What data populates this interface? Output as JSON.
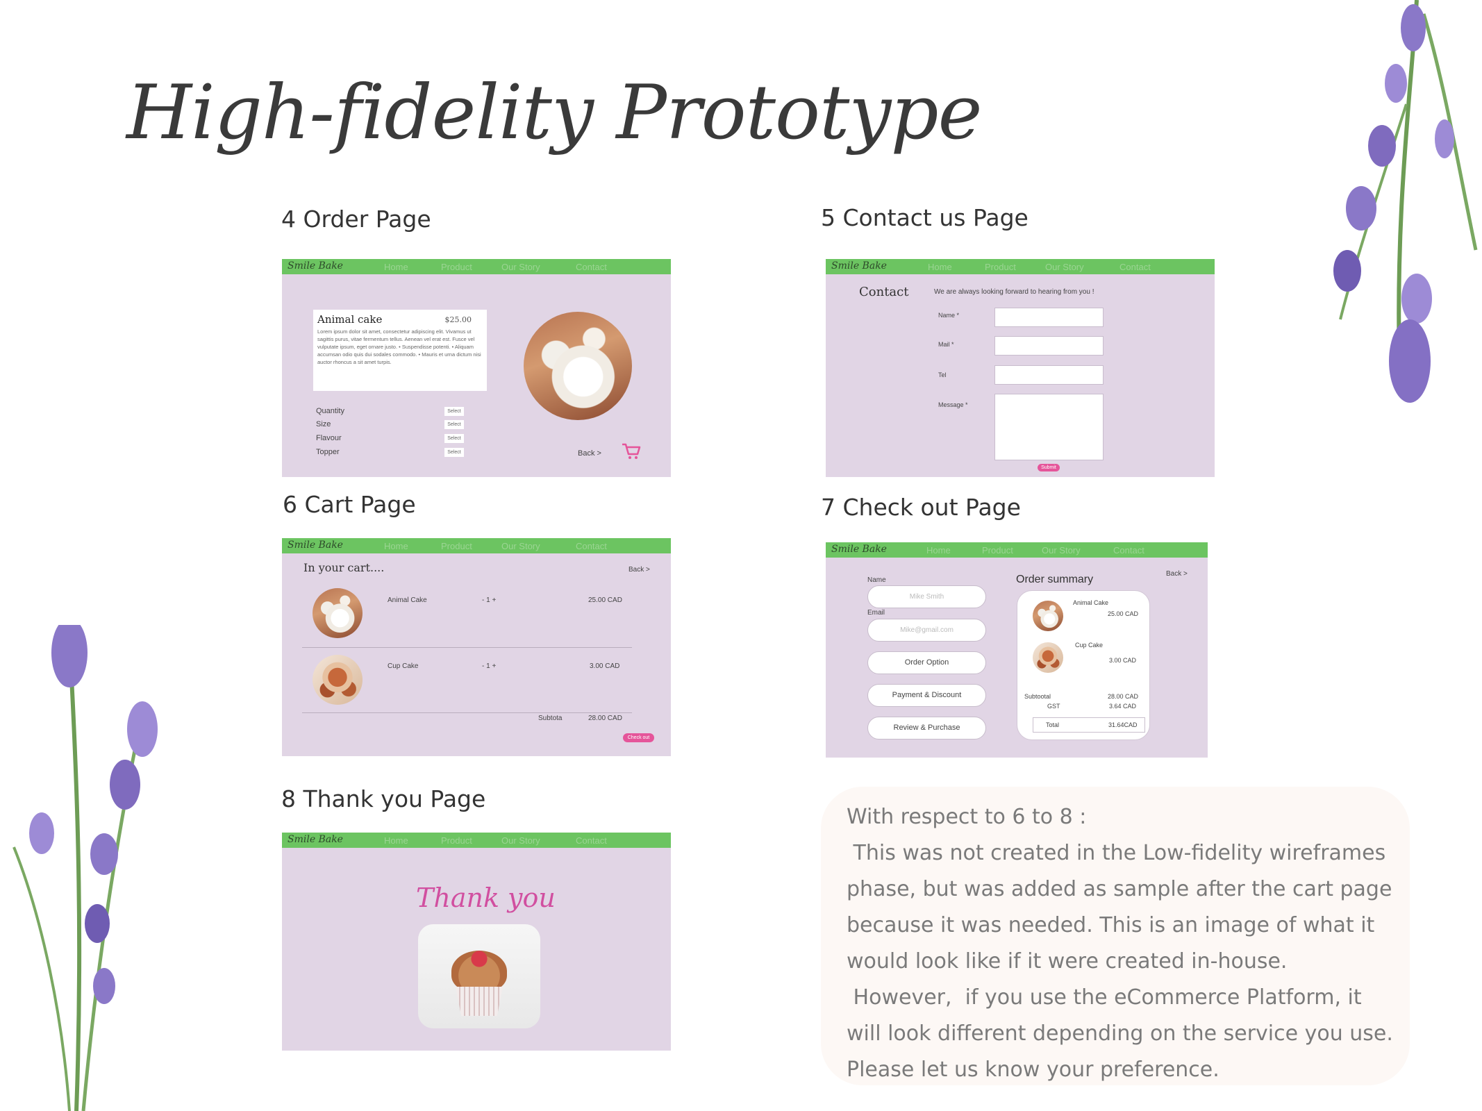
{
  "title": "High-fidelity Prototype",
  "nav": {
    "brand": "Smile Bake",
    "links": [
      "Home",
      "Product",
      "Our Story",
      "Contact"
    ]
  },
  "sections": {
    "order": "4 Order Page",
    "contact": "5 Contact us Page",
    "cart": "6 Cart Page",
    "checkout": "7 Check out Page",
    "thankyou": "8 Thank you Page"
  },
  "order": {
    "product_name": "Animal cake",
    "price": "$25.00",
    "description": "Lorem ipsum dolor sit amet, consectetur adipiscing elit. Vivamus ut sagittis purus, vitae fermentum tellus. Aenean vel erat est. Fusce vel vulputate ipsum, eget ornare justo. • Suspendisse potenti. • Aliquam accumsan odio quis dui sodales commodo. • Mauris et urna dictum nisi auctor rhoncus a sit amet turpis.",
    "options": [
      "Quantity",
      "Size",
      "Flavour",
      "Topper"
    ],
    "select_label": "Select",
    "back": "Back >"
  },
  "contact": {
    "heading": "Contact",
    "intro": "We are always looking forward to hearing from you !",
    "fields": [
      "Name *",
      "Mail *",
      "Tel",
      "Message *"
    ],
    "submit": "Submit"
  },
  "cart": {
    "heading": "In your cart....",
    "back": "Back >",
    "items": [
      {
        "name": "Animal Cake",
        "qty": "- 1 +",
        "price": "25.00 CAD"
      },
      {
        "name": "Cup Cake",
        "qty": "- 1 +",
        "price": "3.00 CAD"
      }
    ],
    "subtotal_label": "Subtota",
    "subtotal_value": "28.00 CAD",
    "checkout": "Check out"
  },
  "checkout": {
    "back": "Back >",
    "name_label": "Name",
    "name_placeholder": "Mike Smith",
    "email_label": "Email",
    "email_placeholder": "Mike@gmail.com",
    "steps": [
      "Order Option",
      "Payment & Discount",
      "Review & Purchase"
    ],
    "summary_title": "Order summary",
    "summary_items": [
      {
        "name": "Animal Cake",
        "price": "25.00 CAD"
      },
      {
        "name": "Cup Cake",
        "price": "3.00 CAD"
      }
    ],
    "subtotal_label": "Subtootal",
    "subtotal_value": "28.00 CAD",
    "gst_label": "GST",
    "gst_value": "3.64 CAD",
    "total_label": "Total",
    "total_value": "31.64CAD"
  },
  "thankyou": {
    "heading": "Thank you"
  },
  "note": "With respect to 6 to 8 :\n This was not created in the Low-fidelity wireframes phase, but was added as sample after the cart page because it was needed. This is an image of what it would look like if it were created in-house.\n However,  if you use the eCommerce Platform, it will look different depending on the service you use. Please let us know your preference.",
  "colors": {
    "frame_bg": "#e1d5e5",
    "nav_green": "#6cc461",
    "accent_pink": "#e5559a",
    "thank_pink": "#d14fa0"
  }
}
